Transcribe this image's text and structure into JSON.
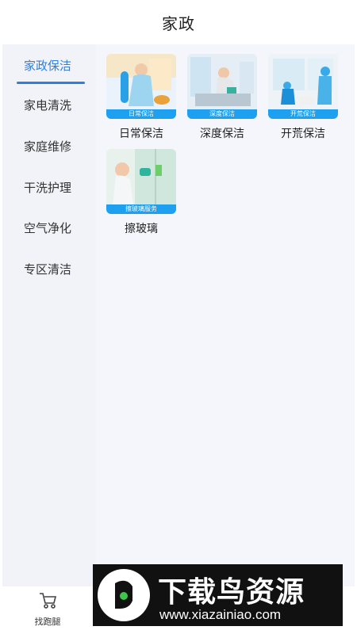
{
  "header": {
    "title": "家政"
  },
  "sidebar": {
    "items": [
      {
        "label": "家政保洁",
        "active": true
      },
      {
        "label": "家电清洗",
        "active": false
      },
      {
        "label": "家庭维修",
        "active": false
      },
      {
        "label": "干洗护理",
        "active": false
      },
      {
        "label": "空气净化",
        "active": false
      },
      {
        "label": "专区清洁",
        "active": false
      }
    ]
  },
  "services": [
    {
      "label": "日常保洁",
      "badge": "日常保洁"
    },
    {
      "label": "深度保洁",
      "badge": "深度保洁"
    },
    {
      "label": "开荒保洁",
      "badge": "开荒保洁"
    },
    {
      "label": "擦玻璃",
      "badge": "擦玻璃服务"
    }
  ],
  "bottom_nav": {
    "items": [
      {
        "label": "找跑腿",
        "icon": "cart-icon"
      }
    ]
  },
  "watermark": {
    "title": "下载鸟资源",
    "url": "www.xiazainiao.com"
  },
  "colors": {
    "accent": "#2f7fe0",
    "badge": "#1ea0f0",
    "sidebar_bg": "#f1f3f8"
  }
}
